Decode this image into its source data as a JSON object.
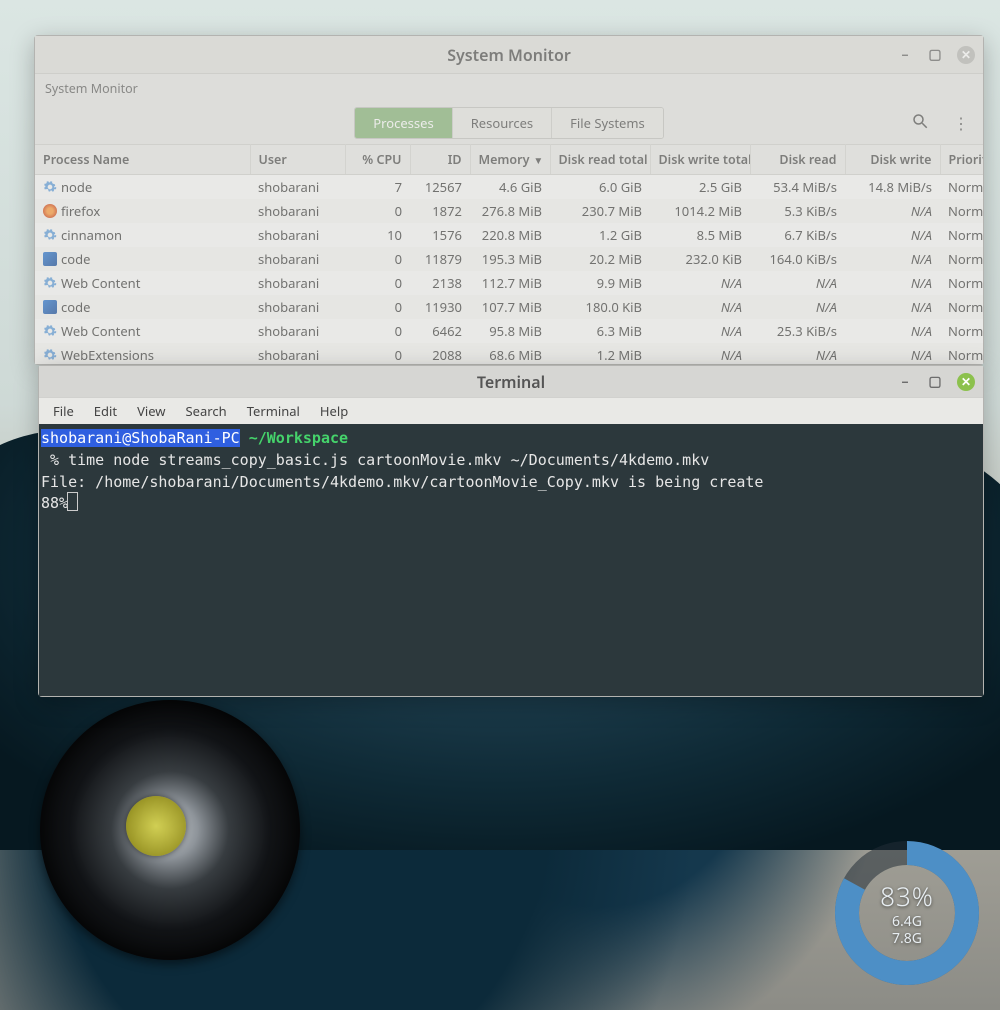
{
  "sysmon": {
    "window_title": "System Monitor",
    "subtitle": "System Monitor",
    "tabs": {
      "processes": "Processes",
      "resources": "Resources",
      "filesystems": "File Systems"
    },
    "columns": {
      "name": "Process Name",
      "user": "User",
      "cpu": "% CPU",
      "id": "ID",
      "memory": "Memory",
      "disk_read_total": "Disk read total",
      "disk_write_total": "Disk write total",
      "disk_read": "Disk read",
      "disk_write": "Disk write",
      "priority": "Priority"
    },
    "sort_column": "memory",
    "sort_dir": "desc",
    "rows": [
      {
        "icon": "gear",
        "name": "node",
        "user": "shobarani",
        "cpu": "7",
        "id": "12567",
        "memory": "4.6 GiB",
        "drt": "6.0 GiB",
        "dwt": "2.5 GiB",
        "dr": "53.4 MiB/s",
        "dw": "14.8 MiB/s",
        "prio": "Normal"
      },
      {
        "icon": "firefox",
        "name": "firefox",
        "user": "shobarani",
        "cpu": "0",
        "id": "1872",
        "memory": "276.8 MiB",
        "drt": "230.7 MiB",
        "dwt": "1014.2 MiB",
        "dr": "5.3 KiB/s",
        "dw": "N/A",
        "prio": "Normal"
      },
      {
        "icon": "gear",
        "name": "cinnamon",
        "user": "shobarani",
        "cpu": "10",
        "id": "1576",
        "memory": "220.8 MiB",
        "drt": "1.2 GiB",
        "dwt": "8.5 MiB",
        "dr": "6.7 KiB/s",
        "dw": "N/A",
        "prio": "Normal"
      },
      {
        "icon": "code",
        "name": "code",
        "user": "shobarani",
        "cpu": "0",
        "id": "11879",
        "memory": "195.3 MiB",
        "drt": "20.2 MiB",
        "dwt": "232.0 KiB",
        "dr": "164.0 KiB/s",
        "dw": "N/A",
        "prio": "Normal"
      },
      {
        "icon": "gear",
        "name": "Web Content",
        "user": "shobarani",
        "cpu": "0",
        "id": "2138",
        "memory": "112.7 MiB",
        "drt": "9.9 MiB",
        "dwt": "N/A",
        "dr": "N/A",
        "dw": "N/A",
        "prio": "Normal"
      },
      {
        "icon": "code",
        "name": "code",
        "user": "shobarani",
        "cpu": "0",
        "id": "11930",
        "memory": "107.7 MiB",
        "drt": "180.0 KiB",
        "dwt": "N/A",
        "dr": "N/A",
        "dw": "N/A",
        "prio": "Normal"
      },
      {
        "icon": "gear",
        "name": "Web Content",
        "user": "shobarani",
        "cpu": "0",
        "id": "6462",
        "memory": "95.8 MiB",
        "drt": "6.3 MiB",
        "dwt": "N/A",
        "dr": "25.3 KiB/s",
        "dw": "N/A",
        "prio": "Normal"
      },
      {
        "icon": "gear",
        "name": "WebExtensions",
        "user": "shobarani",
        "cpu": "0",
        "id": "2088",
        "memory": "68.6 MiB",
        "drt": "1.2 MiB",
        "dwt": "N/A",
        "dr": "N/A",
        "dw": "N/A",
        "prio": "Normal"
      }
    ]
  },
  "terminal": {
    "title": "Terminal",
    "menu": {
      "file": "File",
      "edit": "Edit",
      "view": "View",
      "search": "Search",
      "terminal": "Terminal",
      "help": "Help"
    },
    "prompt_user": "shobarani@ShobaRani-PC",
    "prompt_cwd": "~/Workspace",
    "cmd_symbol": "%",
    "command": "time node streams_copy_basic.js cartoonMovie.mkv ~/Documents/4kdemo.mkv",
    "output_line": "File: /home/shobarani/Documents/4kdemo.mkv/cartoonMovie_Copy.mkv is being create",
    "progress_line": "88%"
  },
  "gauge": {
    "percent": 83,
    "percent_label": "83%",
    "used": "6.4G",
    "total": "7.8G"
  }
}
